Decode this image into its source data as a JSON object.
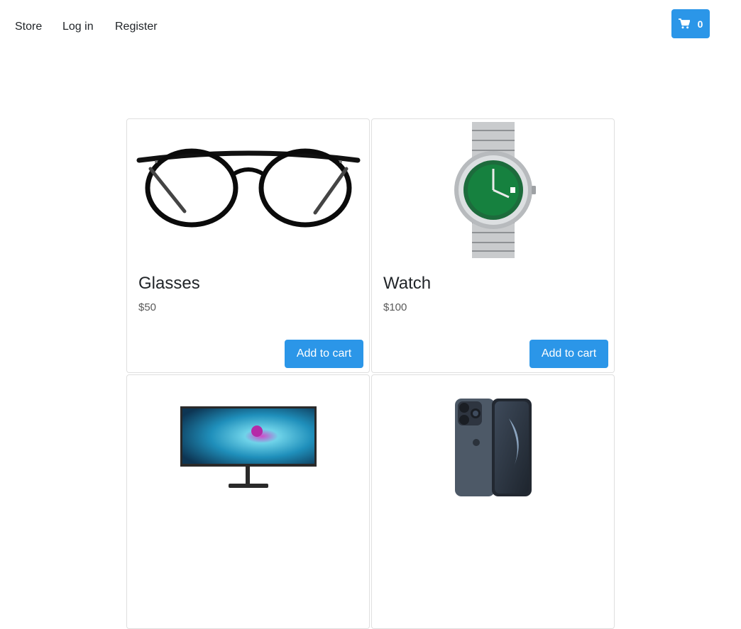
{
  "nav": {
    "links": [
      "Store",
      "Log in",
      "Register"
    ],
    "cart_count": "0"
  },
  "colors": {
    "accent": "#2b96e8",
    "border": "#dfdfdf"
  },
  "products": [
    {
      "name": "Glasses",
      "price": "$50",
      "button": "Add to cart",
      "icon": "glasses-image"
    },
    {
      "name": "Watch",
      "price": "$100",
      "button": "Add to cart",
      "icon": "watch-image"
    },
    {
      "icon": "monitor-image"
    },
    {
      "icon": "phone-image"
    }
  ]
}
